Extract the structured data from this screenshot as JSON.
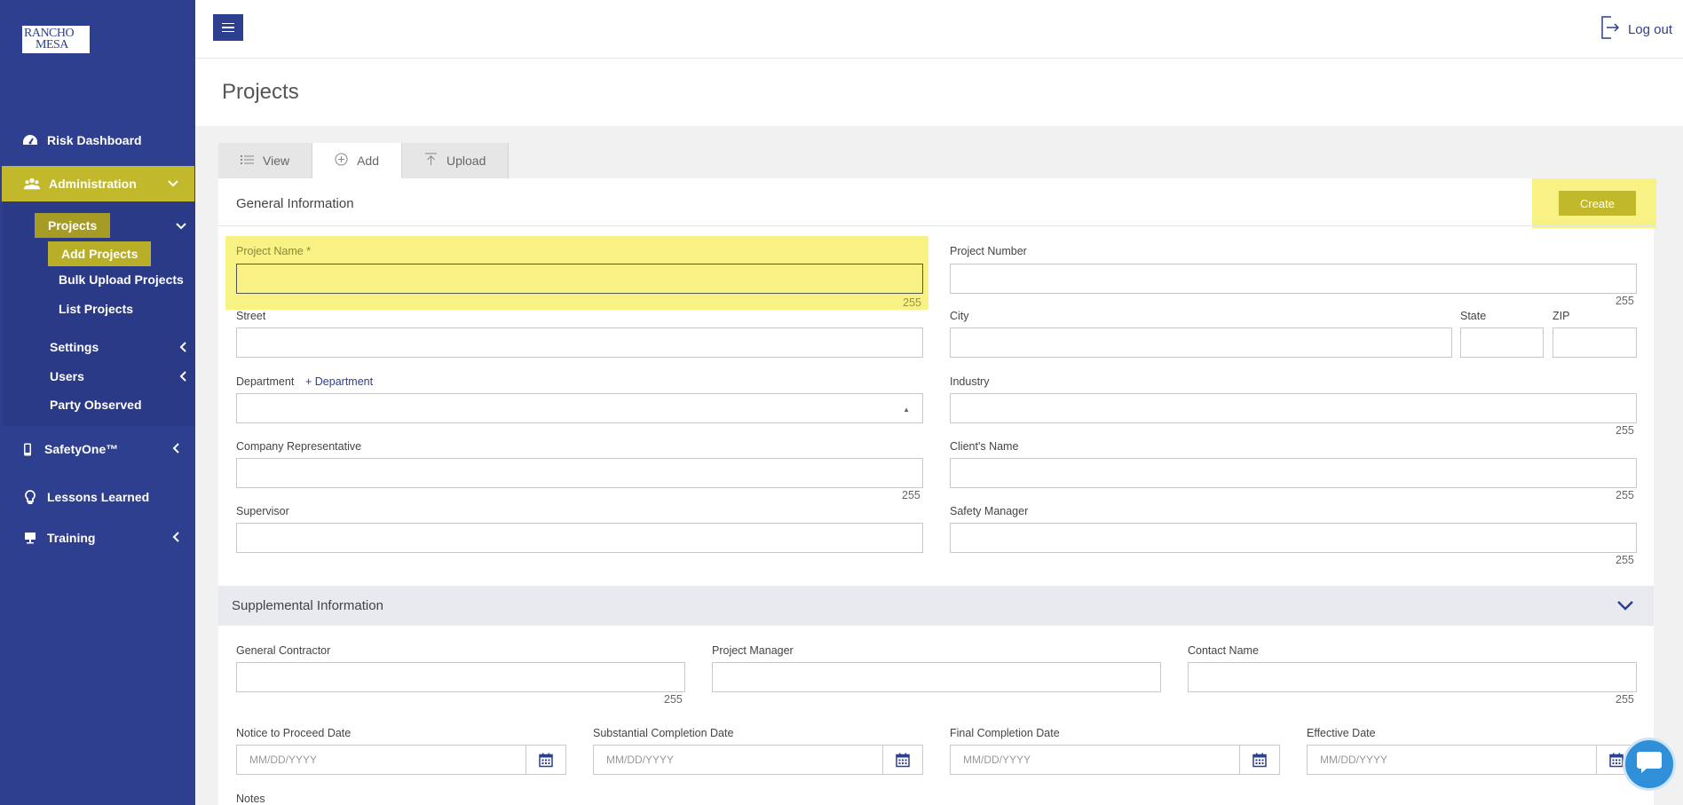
{
  "logo": {
    "line1": "RANCHO",
    "line2": "MESA"
  },
  "sidebar": {
    "risk_dashboard": "Risk Dashboard",
    "administration": "Administration",
    "projects": "Projects",
    "add_projects": "Add Projects",
    "bulk_upload": "Bulk Upload Projects",
    "list_projects": "List Projects",
    "settings": "Settings",
    "users": "Users",
    "party_observed": "Party Observed",
    "safetyone": "SafetyOne™",
    "lessons_learned": "Lessons Learned",
    "training": "Training"
  },
  "header": {
    "logout": "Log out",
    "page_title": "Projects"
  },
  "tabs": [
    {
      "label": "View"
    },
    {
      "label": "Add"
    },
    {
      "label": "Upload"
    }
  ],
  "general": {
    "title": "General Information",
    "create": "Create",
    "project_name": "Project Name *",
    "project_number": "Project Number",
    "street": "Street",
    "city": "City",
    "state": "State",
    "zip": "ZIP",
    "department": "Department",
    "add_department": "+ Department",
    "industry": "Industry",
    "company_rep": "Company Representative",
    "clients_name": "Client's Name",
    "supervisor": "Supervisor",
    "safety_manager": "Safety Manager",
    "max_len": "255"
  },
  "supplemental": {
    "title": "Supplemental Information",
    "general_contractor": "General Contractor",
    "project_manager": "Project Manager",
    "contact_name": "Contact Name",
    "ntp_date": "Notice to Proceed Date",
    "substantial_date": "Substantial Completion Date",
    "final_date": "Final Completion Date",
    "effective_date": "Effective Date",
    "date_placeholder": "MM/DD/YYYY",
    "notes": "Notes"
  },
  "colors": {
    "brand": "#2e3f8f",
    "accent": "#c2b82b",
    "highlight": "#f8f183"
  }
}
